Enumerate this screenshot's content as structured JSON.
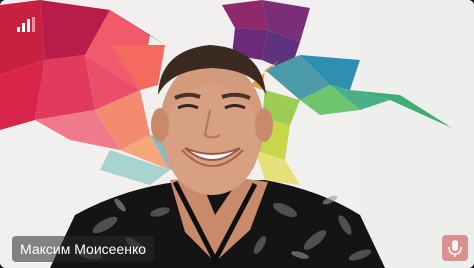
{
  "participant": {
    "name": "Максим Моисеенко",
    "signal_icon": "signal-strength-icon",
    "mic_icon": "mic-muted-icon"
  },
  "colors": {
    "wall": "#f1f0ee",
    "name_tag_bg": "rgba(40,40,40,0.55)",
    "mic_bg": "rgba(200,70,70,0.55)"
  }
}
